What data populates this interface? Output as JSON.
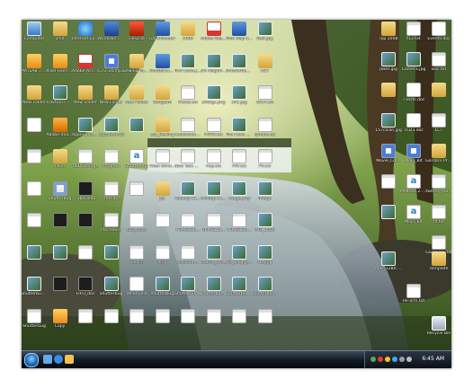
{
  "desktop": {
    "icons_left": [
      {
        "label": "Computer",
        "kind": "comp"
      },
      {
        "label": "MATLAB 7.6 (R2008a)",
        "kind": "exe"
      },
      {
        "label": "New Folder",
        "kind": "folder"
      },
      {
        "label": "",
        "kind": "doc"
      },
      {
        "label": "",
        "kind": "txt"
      },
      {
        "label": "",
        "kind": "doc"
      },
      {
        "label": "",
        "kind": "txt"
      },
      {
        "label": "",
        "kind": "img"
      },
      {
        "label": "Shutterbug - Facebook",
        "kind": "img"
      },
      {
        "label": "Shutterbug",
        "kind": "txt"
      },
      {
        "label": "vmd",
        "kind": "folder"
      },
      {
        "label": "Pixel Fixer Plus vv 1.2",
        "kind": "exe"
      },
      {
        "label": "Fraction Image",
        "kind": "img"
      },
      {
        "label": "Adobe Image Ready",
        "kind": "orange"
      },
      {
        "label": "Paint",
        "kind": "folder"
      },
      {
        "label": "Shutterbug",
        "kind": "sat"
      },
      {
        "label": "",
        "kind": "dark"
      },
      {
        "label": "",
        "kind": "img"
      },
      {
        "label": "",
        "kind": "dark"
      },
      {
        "label": "Copy",
        "kind": "exe"
      },
      {
        "label": "Internet Explorer",
        "kind": "ie"
      },
      {
        "label": "Adobe Acrobat 9",
        "kind": "pdf"
      },
      {
        "label": "New Folder",
        "kind": "folder"
      },
      {
        "label": "Apple Software Update",
        "kind": "img"
      },
      {
        "label": "USB Storage",
        "kind": "txt"
      },
      {
        "label": "TubeDelta",
        "kind": "dark"
      },
      {
        "label": "",
        "kind": "dark"
      },
      {
        "label": "",
        "kind": "txt"
      },
      {
        "label": "FIFO_doc",
        "kind": "dark"
      },
      {
        "label": "",
        "kind": "txt"
      },
      {
        "label": "Windows Media Player",
        "kind": "media"
      },
      {
        "label": "CTU-24.mp3",
        "kind": "audio"
      },
      {
        "label": "New Folder",
        "kind": "folder"
      },
      {
        "label": "Capture.PNG",
        "kind": "img"
      },
      {
        "label": "Program",
        "kind": "txt"
      },
      {
        "label": "Interface",
        "kind": "txt"
      },
      {
        "label": "Procedure",
        "kind": "txt"
      },
      {
        "label": "",
        "kind": "img"
      },
      {
        "label": "Shutterbug",
        "kind": "img"
      },
      {
        "label": "",
        "kind": "txt"
      },
      {
        "label": "FileZilla",
        "kind": "red"
      },
      {
        "label": "Sewing Fabric Icon",
        "kind": "folder"
      },
      {
        "label": "New Folder",
        "kind": "folder"
      },
      {
        "label": "",
        "kind": "img"
      },
      {
        "label": "Shutterbug",
        "kind": "letter"
      },
      {
        "label": "",
        "kind": "txt"
      },
      {
        "label": "blog.docx",
        "kind": "doc"
      },
      {
        "label": "Bleach",
        "kind": "txt"
      },
      {
        "label": "What Jolla",
        "kind": "doc"
      },
      {
        "label": "",
        "kind": "txt"
      },
      {
        "label": "iDownloader",
        "kind": "vsd"
      },
      {
        "label": "Shutterbug - Twitter",
        "kind": "vsd"
      },
      {
        "label": "Songbird",
        "kind": "folder"
      },
      {
        "label": "cat_Sewing",
        "kind": "folder"
      },
      {
        "label": "Fixed Window",
        "kind": "txt"
      },
      {
        "label": "Jot",
        "kind": "folder"
      },
      {
        "label": "",
        "kind": "txt"
      },
      {
        "label": "Prey",
        "kind": "txt"
      },
      {
        "label": "shutterbug",
        "kind": "img"
      },
      {
        "label": "",
        "kind": "txt"
      },
      {
        "label": "2009",
        "kind": "folder"
      },
      {
        "label": "Port Louis.jpg",
        "kind": "img"
      },
      {
        "label": "Frenzi.txt",
        "kind": "txt"
      },
      {
        "label": "Construction of Bus 7 PC...",
        "kind": "txt"
      },
      {
        "label": "New Text Document",
        "kind": "txt"
      },
      {
        "label": "iclonap-11...",
        "kind": "img"
      },
      {
        "label": "HRMS128...",
        "kind": "txt"
      },
      {
        "label": "blackout-...",
        "kind": "txt"
      },
      {
        "label": "Shutterbug-...",
        "kind": "img"
      },
      {
        "label": "",
        "kind": "txt"
      },
      {
        "label": "Adobe Reader",
        "kind": "pdf"
      },
      {
        "label": "Nik Magnif Mauritius.jpg",
        "kind": "img"
      },
      {
        "label": "20Gigs.png",
        "kind": "img"
      },
      {
        "label": "FOTO.txt",
        "kind": "txt"
      },
      {
        "label": "Pup.txt",
        "kind": "txt"
      },
      {
        "label": "iclonap-11...",
        "kind": "img"
      },
      {
        "label": "HRMS128...",
        "kind": "txt"
      },
      {
        "label": "obama_blo...",
        "kind": "img"
      },
      {
        "label": "Shutterbug - Apple.jpg",
        "kind": "img"
      },
      {
        "label": "",
        "kind": "txt"
      },
      {
        "label": "Fifth Map of Mauritius...",
        "kind": "vsd"
      },
      {
        "label": "Shutterbug - Twitter.jpg",
        "kind": "img"
      },
      {
        "label": "542.jpg",
        "kind": "img"
      },
      {
        "label": "Fire Cove on Tosh...",
        "kind": "img"
      },
      {
        "label": "FRT.txt",
        "kind": "txt"
      },
      {
        "label": "image.php",
        "kind": "img"
      },
      {
        "label": "HRMS128...",
        "kind": "txt"
      },
      {
        "label": "pic_blog.jp...",
        "kind": "img"
      },
      {
        "label": "Shutterbug - Facebook.jpg",
        "kind": "img"
      },
      {
        "label": "",
        "kind": "txt"
      },
      {
        "label": "Well.jpg",
        "kind": "img"
      },
      {
        "label": "NET",
        "kind": "folder"
      },
      {
        "label": "2014.txt",
        "kind": "txt"
      },
      {
        "label": "Iphone.nu",
        "kind": "txt"
      },
      {
        "label": "FR.txt",
        "kind": "txt"
      },
      {
        "label": "Image",
        "kind": "img"
      },
      {
        "label": "IMG_3659",
        "kind": "img"
      },
      {
        "label": "rbs.jpg",
        "kind": "img"
      },
      {
        "label": "Shutterbug - H3.jpg",
        "kind": "img"
      },
      {
        "label": "",
        "kind": "txt"
      }
    ],
    "icons_right": [
      {
        "label": "Top 2008",
        "kind": "folder"
      },
      {
        "label": "t12.txt",
        "kind": "txt"
      },
      {
        "label": "Events.doc",
        "kind": "doc"
      },
      {
        "label": "Joker.jpg",
        "kind": "img"
      },
      {
        "label": "Camera.jpg",
        "kind": "img"
      },
      {
        "label": "Doc.txt",
        "kind": "txt"
      },
      {
        "label": "",
        "kind": "folder"
      },
      {
        "label": "T-Tests.doc",
        "kind": "doc"
      },
      {
        "label": "",
        "kind": "folder"
      },
      {
        "label": "157cIcon.jpg",
        "kind": "img"
      },
      {
        "label": "TCD3.doc",
        "kind": "doc"
      },
      {
        "label": "LCT",
        "kind": "txt"
      },
      {
        "label": "Movie_Col...",
        "kind": "audio"
      },
      {
        "label": "Mojo_Bit",
        "kind": "audio"
      },
      {
        "label": "Gorilla's Prometheus",
        "kind": "folder"
      },
      {
        "label": "",
        "kind": "txt"
      },
      {
        "label": "Maltese 2.doc",
        "kind": "letter"
      },
      {
        "label": "twitter_mu...",
        "kind": "txt"
      },
      {
        "label": "",
        "kind": "img"
      },
      {
        "label": "Mojo_Bit",
        "kind": "letter"
      },
      {
        "label": "fd.txt",
        "kind": "txt"
      },
      {
        "label": "Giveaway.txt",
        "kind": "txt"
      },
      {
        "label": "epic_1280.jpg",
        "kind": "img"
      },
      {
        "label": "Template",
        "kind": "folder"
      },
      {
        "label": "Re-arm.txt",
        "kind": "txt"
      },
      {
        "label": "Recycle Bin",
        "kind": "bin"
      }
    ]
  },
  "taskbar": {
    "clock": "6:45 AM",
    "quick_launch": [
      "show-desktop",
      "ie",
      "media-player",
      "explorer"
    ],
    "tray": [
      "network",
      "volume",
      "security",
      "update",
      "shield",
      "chat"
    ]
  }
}
